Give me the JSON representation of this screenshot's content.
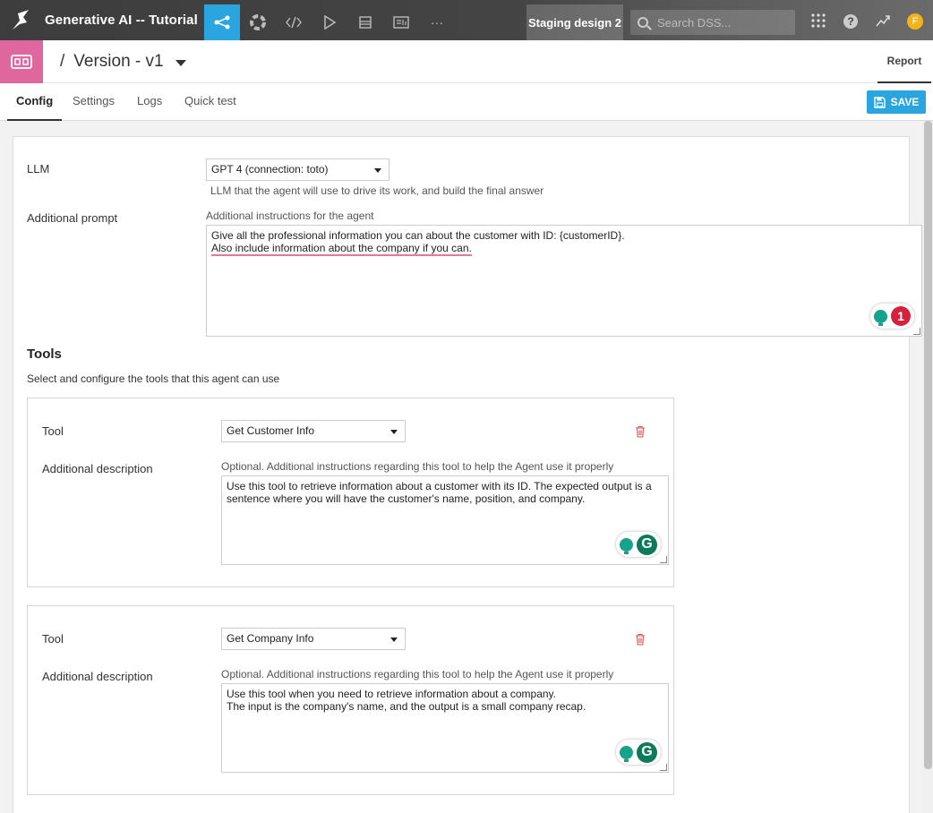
{
  "topnav": {
    "project_title": "Generative AI -- Tutorial",
    "instance_label": "Staging design 2",
    "search_placeholder": "Search DSS...",
    "help_label": "?",
    "avatar_initial": "F",
    "more_label": "···"
  },
  "header": {
    "slash": "/",
    "title": "Version - v1",
    "report_tab": "Report"
  },
  "tabs": {
    "items": [
      "Config",
      "Settings",
      "Logs",
      "Quick test"
    ],
    "active": "Config",
    "save_label": "SAVE"
  },
  "form": {
    "llm_label": "LLM",
    "llm_value": "GPT 4 (connection: toto)",
    "llm_hint": "LLM that the agent will use to drive its work, and build the final answer",
    "prompt_label": "Additional prompt",
    "prompt_hint": "Additional instructions for the agent",
    "prompt_line1": "Give all the professional information you can about the customer with ID:  {customerID}.",
    "prompt_line2": "Also include information about the company if you can.",
    "grammar_count": "1"
  },
  "tools": {
    "title": "Tools",
    "subtitle": "Select and configure the tools that this agent can use",
    "tool_label": "Tool",
    "desc_label": "Additional description",
    "desc_hint": "Optional. Additional instructions regarding this tool to help the Agent use it properly",
    "grammar_logo": "G",
    "items": [
      {
        "name": "Get Customer Info",
        "desc_line1": "Use this tool to retrieve information about a customer with its ID. The expected output is a",
        "desc_line2": "sentence where you will have the customer's name, position, and company."
      },
      {
        "name": "Get Company Info",
        "desc_line1": "Use this tool when you need to retrieve information about a company.",
        "desc_line2": "The input is the company's name, and the output is a small company recap."
      }
    ]
  },
  "colors": {
    "accent": "#2ba5df",
    "object_pink": "#e0679e",
    "grammarly_red": "#d4213d",
    "grammarly_green": "#15a38b",
    "delete_red": "#d9534f"
  }
}
